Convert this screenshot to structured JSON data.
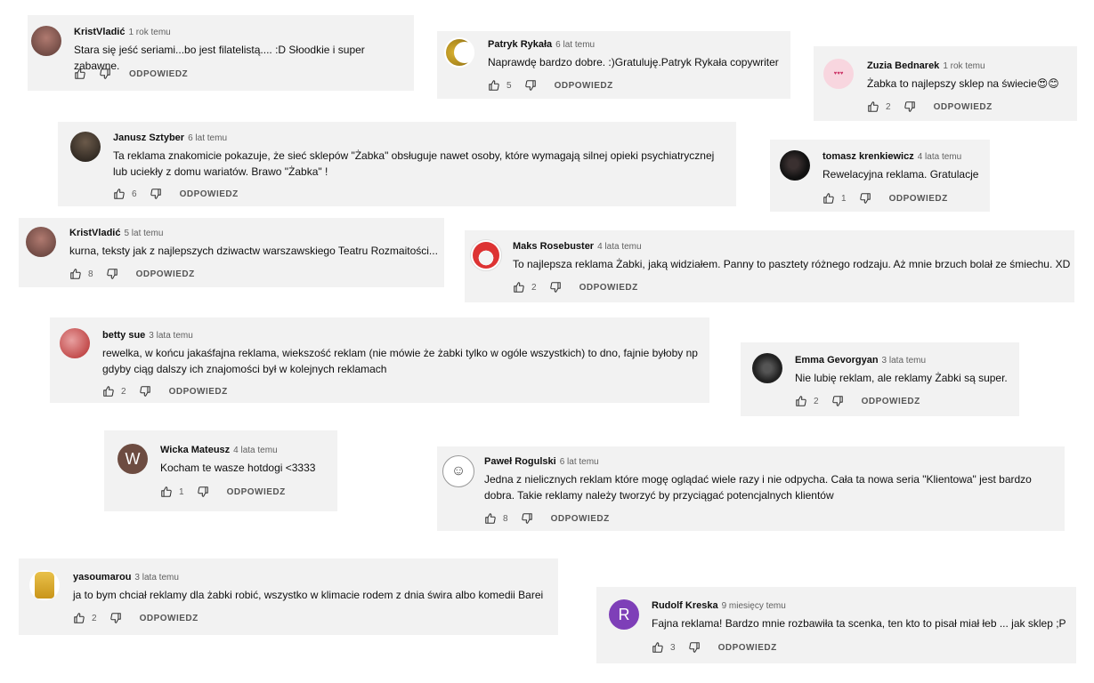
{
  "reply_label": "ODPOWIEDZ",
  "colors": {
    "card_bg": "#f2f2f2",
    "author": "#0f0f0f",
    "meta": "#606060"
  },
  "comments": [
    {
      "author": "KristVladić",
      "time": "1 rok temu",
      "text": "Stara się jeść seriami...bo jest filatelistą.... :D Słoodkie i super zabawne.",
      "likes": ""
    },
    {
      "author": "Patryk Rykała",
      "time": "6 lat temu",
      "text": "Naprawdę bardzo dobre. :)Gratuluję.Patryk Rykała copywriter",
      "likes": "5"
    },
    {
      "author": "Zuzia Bednarek",
      "time": "1 rok temu",
      "text": "Żabka to najlepszy sklep na świecie😍😊",
      "likes": "2"
    },
    {
      "author": "Janusz Sztyber",
      "time": "6 lat temu",
      "text": "Ta reklama znakomicie pokazuje, że sieć sklepów \"Żabka\" obsługuje nawet osoby, które wymagają silnej opieki psychiatrycznej lub uciekły z domu wariatów. Brawo \"Żabka\" !",
      "likes": "6"
    },
    {
      "author": "tomasz krenkiewicz",
      "time": "4 lata temu",
      "text": "Rewelacyjna reklama. Gratulacje",
      "likes": "1"
    },
    {
      "author": "KristVladić",
      "time": "5 lat temu",
      "text": "kurna, teksty jak z najlepszych dziwactw warszawskiego Teatru Rozmaitości...",
      "likes": "8"
    },
    {
      "author": "Maks Rosebuster",
      "time": "4 lata temu",
      "text": "To najlepsza reklama Żabki, jaką widziałem. Panny to pasztety różnego rodzaju. Aż mnie brzuch bolał ze śmiechu. XD",
      "likes": "2"
    },
    {
      "author": "betty sue",
      "time": "3 lata temu",
      "text": "rewelka, w końcu jakaśfajna reklama, wiekszość reklam (nie mówie że żabki tylko w ogóle wszystkich) to dno, fajnie byłoby np gdyby ciąg dalszy ich znajomości był w kolejnych reklamach",
      "likes": "2"
    },
    {
      "author": "Emma Gevorgyan",
      "time": "3 lata temu",
      "text": "Nie lubię reklam, ale reklamy Żabki są super.",
      "likes": "2"
    },
    {
      "author": "Wicka Mateusz",
      "time": "4 lata temu",
      "text": "Kocham te wasze hotdogi <3333",
      "likes": "1",
      "avatar_letter": "W"
    },
    {
      "author": "Paweł Rogulski",
      "time": "6 lat temu",
      "text": "Jedna z nielicznych reklam które mogę oglądać wiele razy i nie odpycha. Cała ta nowa seria \"Klientowa\" jest bardzo dobra. Takie reklamy należy tworzyć by przyciągać potencjalnych klientów",
      "likes": "8"
    },
    {
      "author": "yasoumarou",
      "time": "3 lata temu",
      "text": "ja to bym chciał reklamy dla żabki robić, wszystko w klimacie rodem z dnia świra albo komedii Barei",
      "likes": "2"
    },
    {
      "author": "Rudolf Kreska",
      "time": "9 miesięcy temu",
      "text": "Fajna reklama! Bardzo mnie rozbawiła ta scenka, ten kto to pisał miał łeb ... jak sklep ;P",
      "likes": "3",
      "avatar_letter": "R"
    }
  ]
}
